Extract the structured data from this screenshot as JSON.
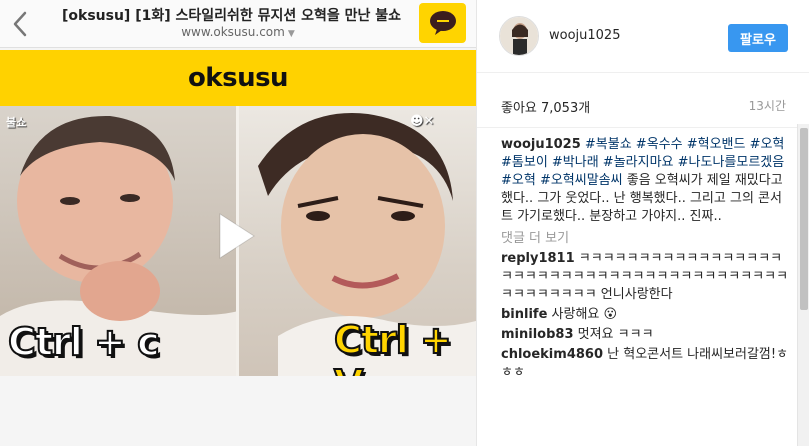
{
  "video_page": {
    "title": "[oksusu] [1화] 스타일리쉬한 뮤지션 오혁을 만난 불쇼",
    "url": "www.oksusu.com",
    "brand": "oksusu",
    "watermark_left": "불쇼",
    "watermark_right": "☻✕",
    "caption_left": "Ctrl + c",
    "caption_right": "Ctrl + V"
  },
  "post": {
    "username": "wooju1025",
    "follow_label": "팔로우",
    "likes": "좋아요 7,053개",
    "time": "13시간",
    "caption_user": "wooju1025",
    "caption_tags": "#복불쇼 #옥수수 #혁오밴드 #오혁 #톰보이 #박나래 #놀라지마요 #나도나를모르겠음 #오혁 #오혁씨말솜씨",
    "caption_text": "좋음 오혁씨가 제일 재밌다고했다.. 그가 웃었다.. 난 행복했다.. 그리고 그의 콘서트 가기로했다.. 분장하고 가야지.. 진짜..",
    "more_comments": "댓글 더 보기"
  },
  "comments": [
    {
      "user": "reply1811",
      "text": "ㅋㅋㅋㅋㅋㅋㅋㅋㅋㅋㅋㅋㅋㅋㅋㅋㅋㅋㅋㅋㅋㅋㅋㅋㅋㅋㅋㅋㅋㅋㅋㅋㅋㅋㅋㅋㅋㅋㅋㅋㅋㅋㅋㅋㅋㅋㅋㅋㅋ 언니사랑한다"
    },
    {
      "user": "binlife",
      "text": "사랑해요 😮"
    },
    {
      "user": "minilob83",
      "text": "멋져요 ㅋㅋㅋ"
    },
    {
      "user": "chloekim4860",
      "text": "난 혁오콘서트 나래씨보러갈껌!ㅎㅎㅎ"
    }
  ],
  "icons": [
    "back-chevron-icon",
    "kakao-talk-icon",
    "play-icon",
    "avatar",
    "dropdown-caret-icon"
  ],
  "colors": {
    "brand_yellow": "#ffd200",
    "follow_blue": "#3897f0",
    "tag_blue": "#003569"
  }
}
